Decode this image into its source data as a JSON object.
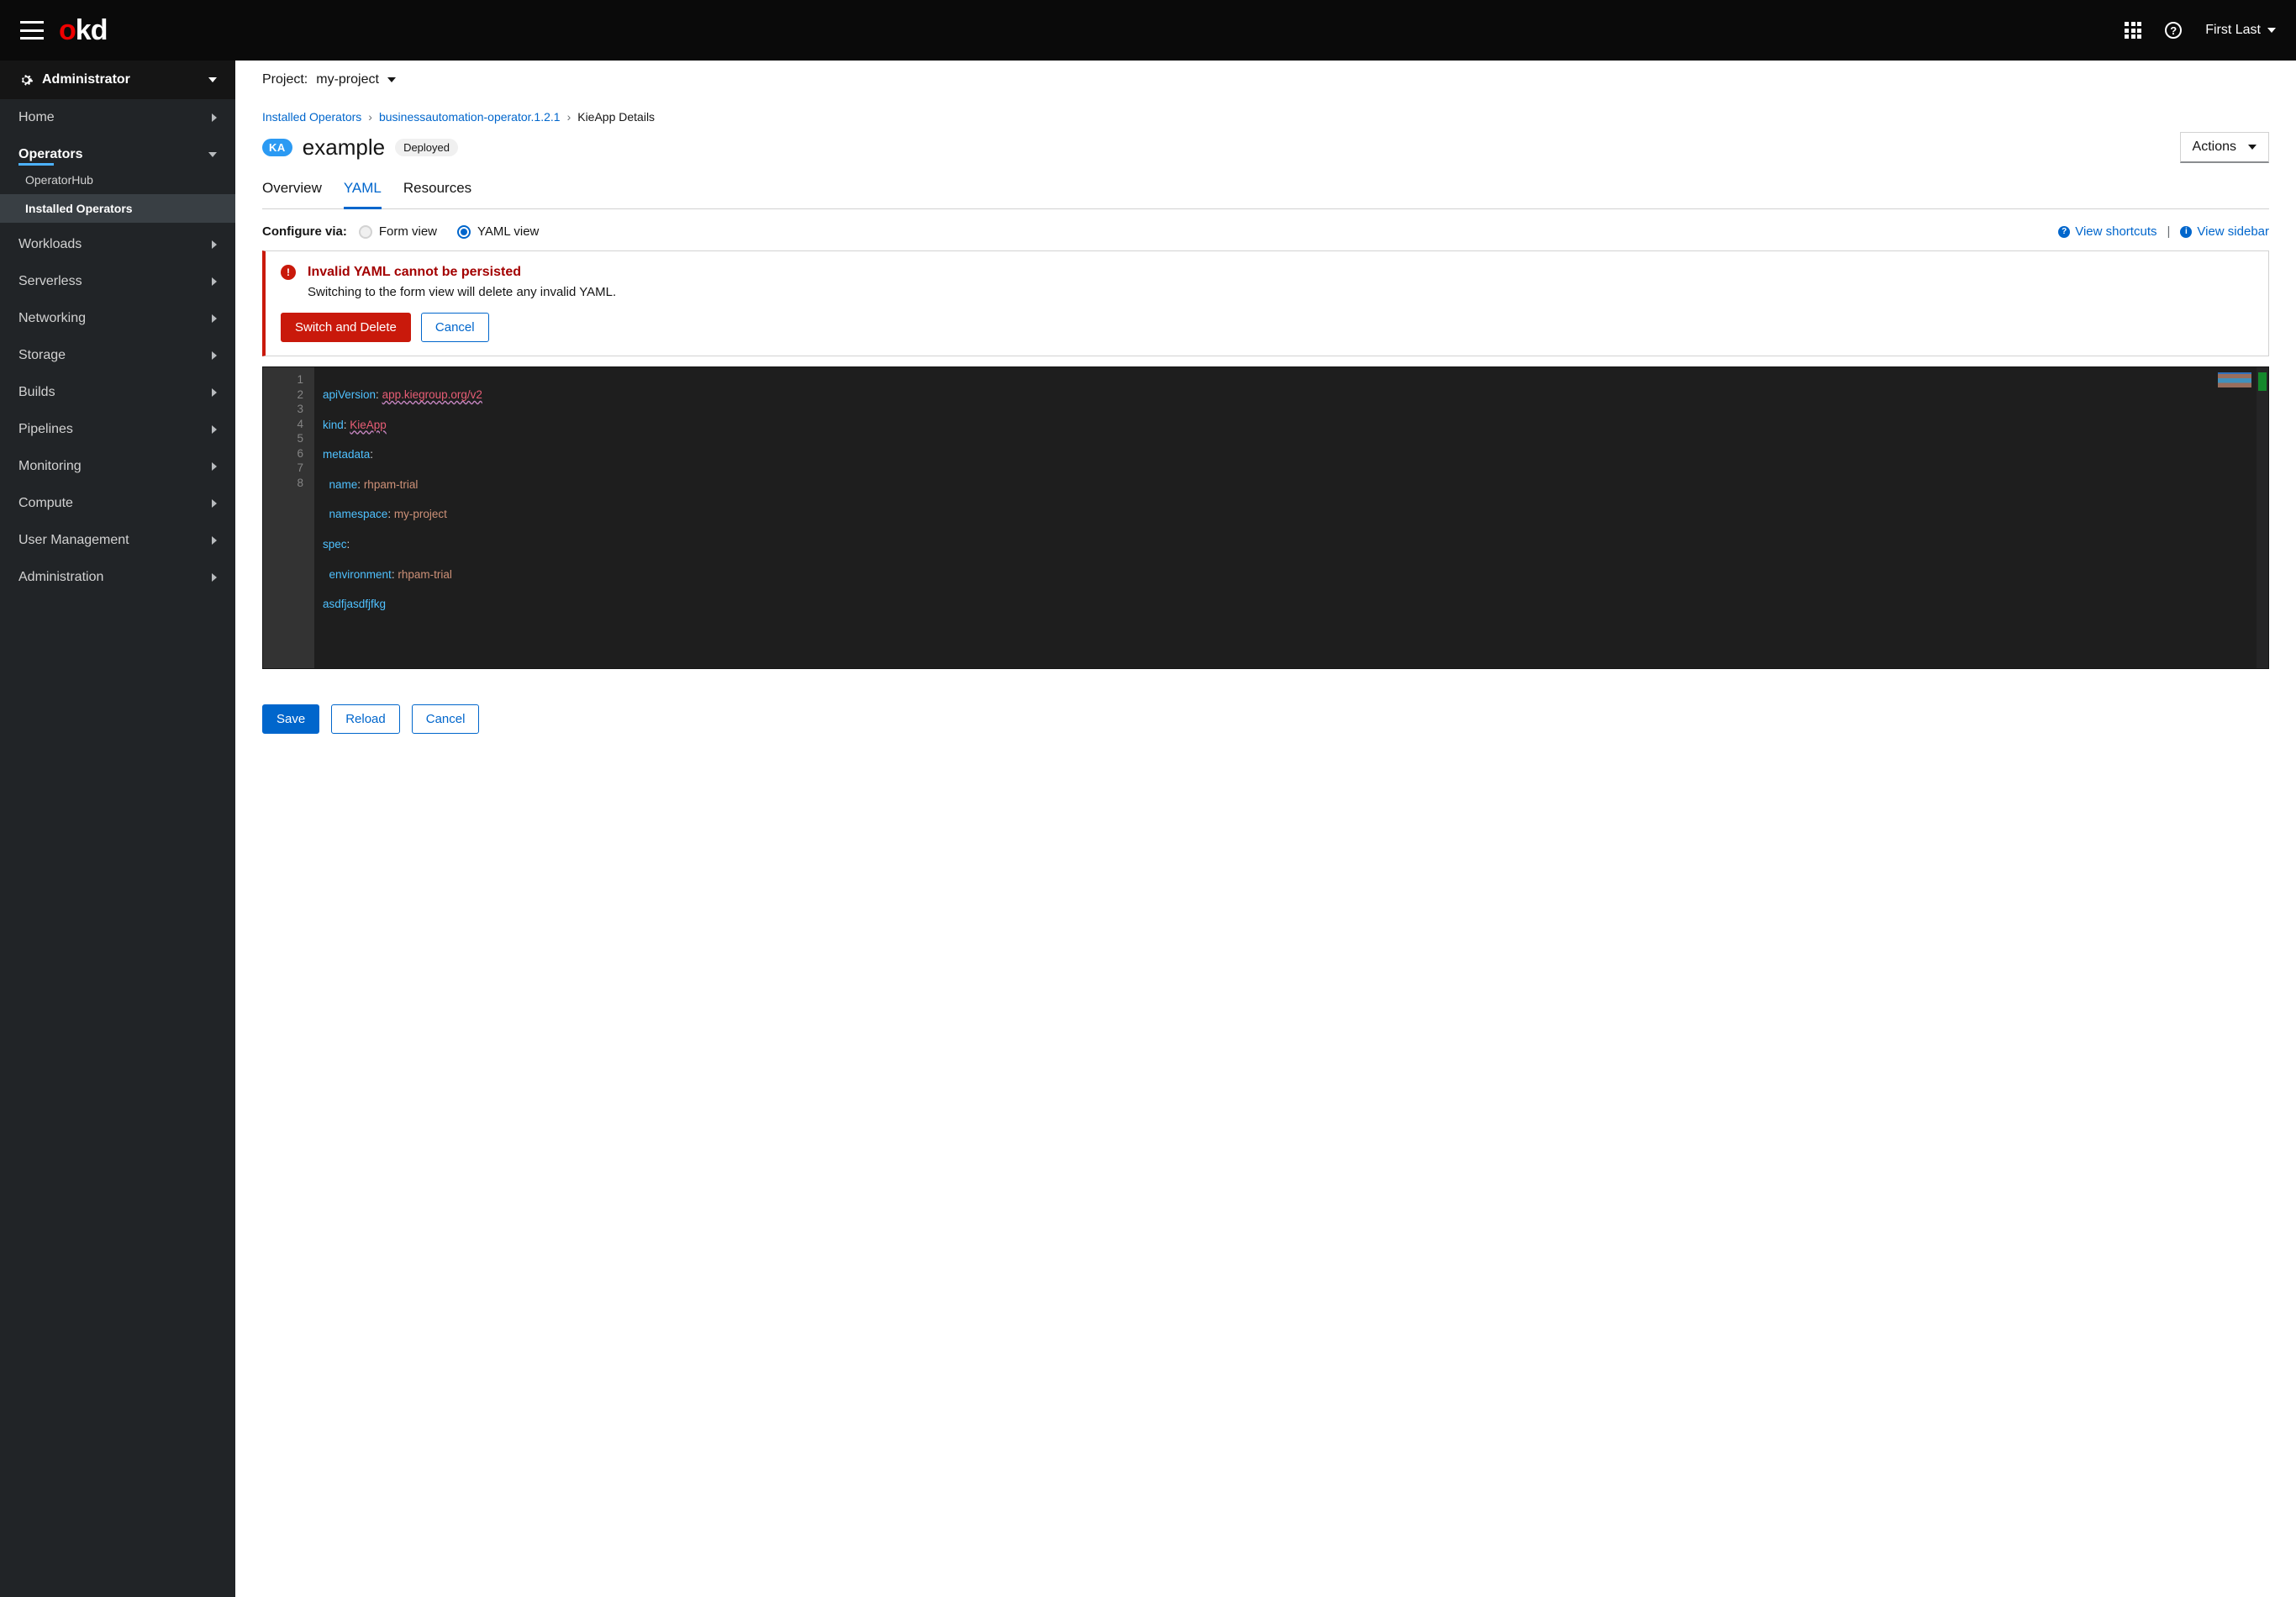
{
  "topbar": {
    "user_name": "First Last"
  },
  "sidebar": {
    "perspective": "Administrator",
    "items": [
      {
        "label": "Home",
        "type": "collapsed"
      },
      {
        "label": "Operators",
        "type": "expanded",
        "active": true,
        "children": [
          {
            "label": "OperatorHub"
          },
          {
            "label": "Installed Operators",
            "active": true
          }
        ]
      },
      {
        "label": "Workloads",
        "type": "collapsed"
      },
      {
        "label": "Serverless",
        "type": "collapsed"
      },
      {
        "label": "Networking",
        "type": "collapsed"
      },
      {
        "label": "Storage",
        "type": "collapsed"
      },
      {
        "label": "Builds",
        "type": "collapsed"
      },
      {
        "label": "Pipelines",
        "type": "collapsed"
      },
      {
        "label": "Monitoring",
        "type": "collapsed"
      },
      {
        "label": "Compute",
        "type": "collapsed"
      },
      {
        "label": "User Management",
        "type": "collapsed"
      },
      {
        "label": "Administration",
        "type": "collapsed"
      }
    ]
  },
  "project": {
    "label": "Project:",
    "value": "my-project"
  },
  "breadcrumb": {
    "a": "Installed Operators",
    "b": "businessautomation-operator.1.2.1",
    "c": "KieApp Details"
  },
  "title": {
    "badge": "KA",
    "text": "example",
    "status": "Deployed",
    "actions": "Actions"
  },
  "tabs": {
    "overview": "Overview",
    "yaml": "YAML",
    "resources": "Resources"
  },
  "config": {
    "label": "Configure via:",
    "form": "Form view",
    "yaml": "YAML view",
    "shortcuts": "View shortcuts",
    "sidebar": "View sidebar"
  },
  "alert": {
    "title": "Invalid YAML cannot be persisted",
    "body": "Switching to the form view will delete any invalid YAML.",
    "primary": "Switch and Delete",
    "secondary": "Cancel"
  },
  "code": {
    "lines": [
      "1",
      "2",
      "3",
      "4",
      "5",
      "6",
      "7",
      "8"
    ],
    "l1k": "apiVersion",
    "l1v": "app.kiegroup.org/v2",
    "l2k": "kind",
    "l2v": "KieApp",
    "l3k": "metadata",
    "l4k": "name",
    "l4v": "rhpam-trial",
    "l5k": "namespace",
    "l5v": "my-project",
    "l6k": "spec",
    "l7k": "environment",
    "l7v": "rhpam-trial",
    "l8": "asdfjasdfjfkg"
  },
  "buttons": {
    "save": "Save",
    "reload": "Reload",
    "cancel": "Cancel"
  }
}
